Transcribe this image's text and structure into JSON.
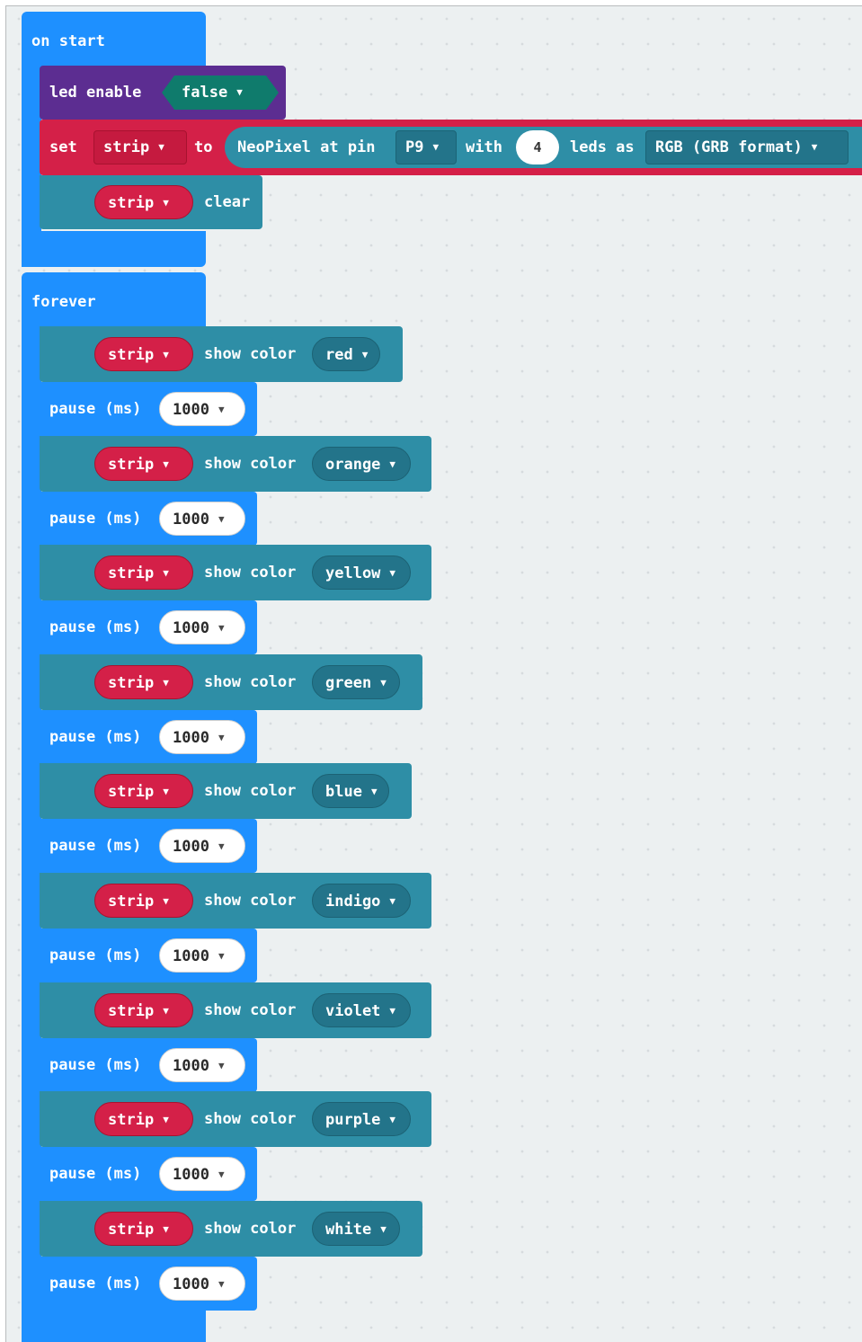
{
  "on_start": {
    "hat_label": "on start",
    "led_enable": {
      "label": "led enable",
      "value": "false"
    },
    "set_strip": {
      "set_label": "set",
      "variable": "strip",
      "to_label": "to",
      "neopixel_label": "NeoPixel at pin",
      "pin": "P9",
      "with_label": "with",
      "led_count": "4",
      "leds_as_label": "leds as",
      "mode": "RGB (GRB format)"
    },
    "clear": {
      "variable": "strip",
      "label": "clear"
    }
  },
  "forever": {
    "hat_label": "forever",
    "show_color_label": "show color",
    "pause_label": "pause (ms)",
    "steps": [
      {
        "variable": "strip",
        "color": "red",
        "pause": "1000"
      },
      {
        "variable": "strip",
        "color": "orange",
        "pause": "1000"
      },
      {
        "variable": "strip",
        "color": "yellow",
        "pause": "1000"
      },
      {
        "variable": "strip",
        "color": "green",
        "pause": "1000"
      },
      {
        "variable": "strip",
        "color": "blue",
        "pause": "1000"
      },
      {
        "variable": "strip",
        "color": "indigo",
        "pause": "1000"
      },
      {
        "variable": "strip",
        "color": "violet",
        "pause": "1000"
      },
      {
        "variable": "strip",
        "color": "purple",
        "pause": "1000"
      },
      {
        "variable": "strip",
        "color": "white",
        "pause": "1000"
      }
    ]
  },
  "colors": {
    "workspace": "#ecf0f1",
    "event_block": "#1e90ff",
    "led_block": "#5c2d91",
    "neopixel_block": "#2e8ea6",
    "variable_block": "#d42048",
    "boolean_block": "#0f7b6c"
  },
  "icons": {
    "dropdown": "dropdown-caret-icon"
  }
}
